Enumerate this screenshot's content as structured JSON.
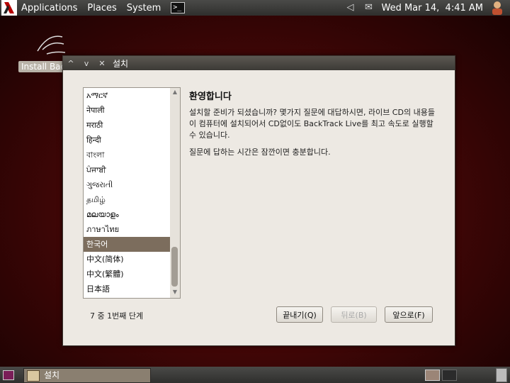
{
  "top_panel": {
    "menus": [
      "Applications",
      "Places",
      "System"
    ],
    "clock": "Wed Mar 14,  4:41 AM"
  },
  "desktop": {
    "install_icon_label": "Install Bac"
  },
  "window": {
    "title": "설치",
    "languages": [
      "አማርኛ",
      "नेपाली",
      "मराठी",
      "हिन्दी",
      "বাংলা",
      "ਪੰਜਾਬੀ",
      "ગુજરાતી",
      "தமிழ்",
      "മലയാളം",
      "ภาษาไทย",
      "한국어",
      "中文(简体)",
      "中文(繁體)",
      "日本語"
    ],
    "selected_language": "한국어",
    "heading": "환영합니다",
    "paragraph1": "설치할 준비가 되셨습니까? 몇가지 질문에 대답하시면, 라이브 CD의 내용들이 컴퓨터에 설치되어서 CD없이도 BackTrack Live를 최고 속도로 실행할 수 있습니다.",
    "paragraph2": "질문에 답하는 시간은 잠깐이면 충분합니다.",
    "step": "7 중 1번째 단계",
    "buttons": {
      "quit": "끝내기(Q)",
      "back": "뒤로(B)",
      "forward": "앞으로(F)"
    }
  },
  "bottom_panel": {
    "task_label": "설치"
  },
  "colors": {
    "selection": "#7c6d5d",
    "desktop_red": "#6a0c0c"
  }
}
